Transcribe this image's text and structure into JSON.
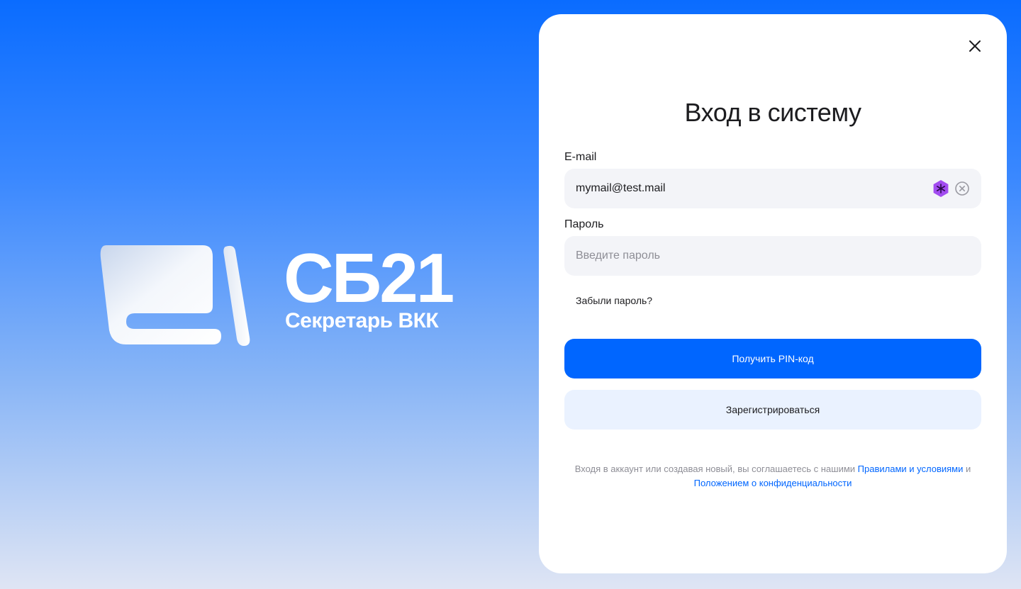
{
  "brand": {
    "name": "СБ21",
    "subtitle": "Секретарь ВКК"
  },
  "login": {
    "title": "Вход в систему",
    "email": {
      "label": "E-mail",
      "value": "mymail@test.mail"
    },
    "password": {
      "label": "Пароль",
      "placeholder": "Введите пароль"
    },
    "forgot_label": "Забыли пароль?",
    "get_pin_label": "Получить PIN-код",
    "register_label": "Зарегистрироваться",
    "legal": {
      "prefix": "Входя в аккаунт или создавая новый, вы соглашаетесь с нашими",
      "terms_link": "Правилами и условиями",
      "conjunction": "и",
      "privacy_link": "Положением о конфиденциальности"
    }
  },
  "icons": {
    "close": "close-icon",
    "password_manager": "password-manager-icon",
    "clear": "clear-input-icon"
  },
  "colors": {
    "accent": "#0066ff",
    "secondary_button": "#eaf2ff",
    "input_bg": "#f3f4f8",
    "password_manager": "#a24cf0"
  }
}
